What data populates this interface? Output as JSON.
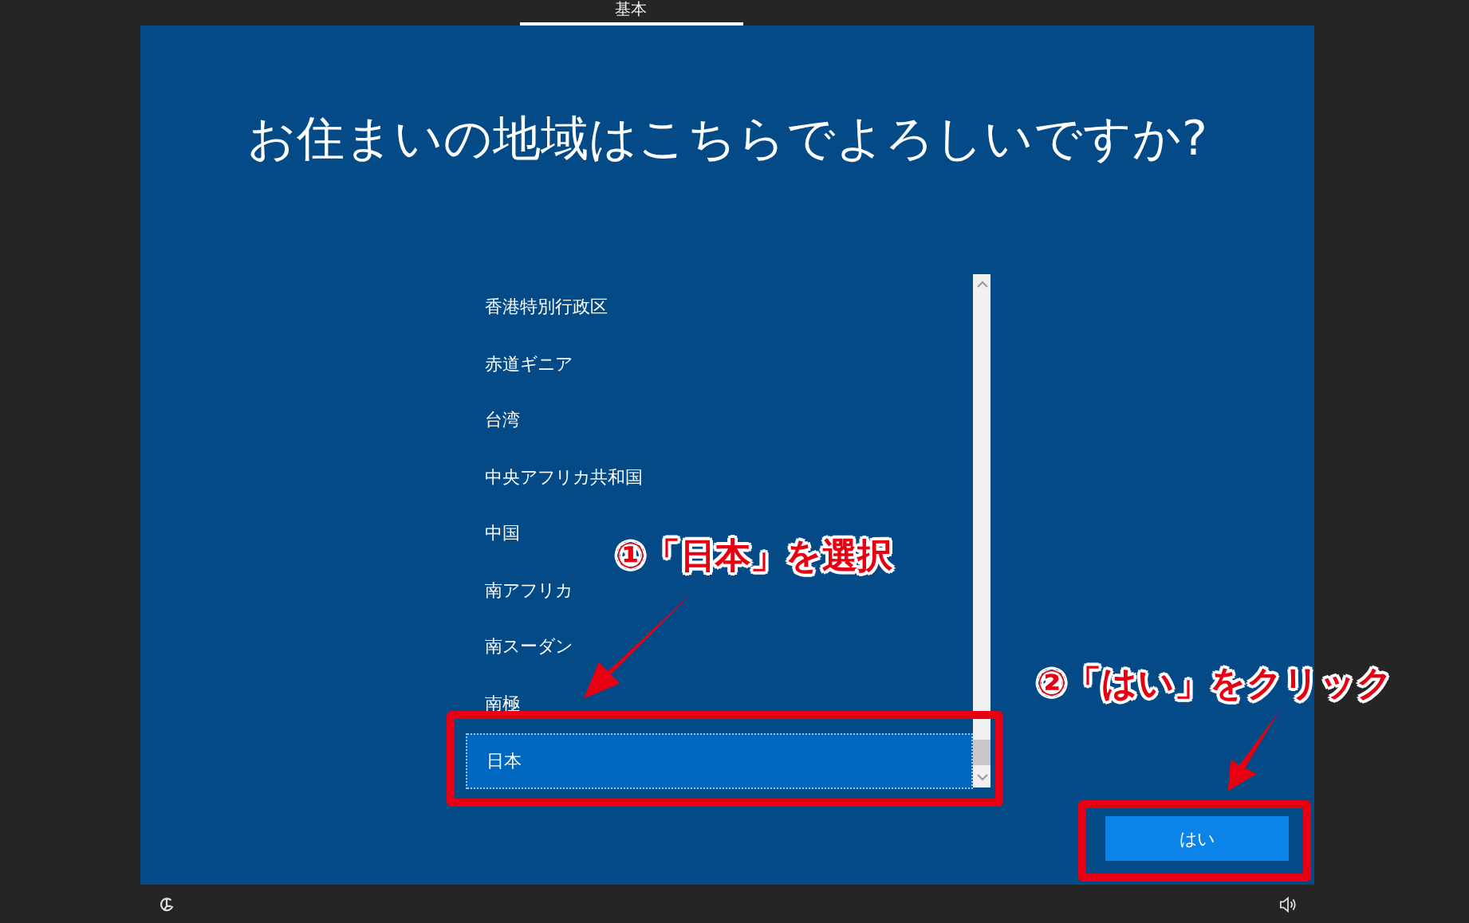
{
  "tabs": [
    {
      "label": "基本",
      "selected": true
    }
  ],
  "title": "お住まいの地域はこちらでよろしいですか?",
  "countries": [
    {
      "name": "香港特別行政区",
      "selected": false
    },
    {
      "name": "赤道ギニア",
      "selected": false
    },
    {
      "name": "台湾",
      "selected": false
    },
    {
      "name": "中央アフリカ共和国",
      "selected": false
    },
    {
      "name": "中国",
      "selected": false
    },
    {
      "name": "南アフリカ",
      "selected": false
    },
    {
      "name": "南スーダン",
      "selected": false
    },
    {
      "name": "南極",
      "selected": false
    },
    {
      "name": "日本",
      "selected": true
    }
  ],
  "yes_button": "はい",
  "annotations": [
    {
      "number": "①",
      "text": "「日本」を選択"
    },
    {
      "number": "②",
      "text": "「はい」をクリック"
    }
  ]
}
